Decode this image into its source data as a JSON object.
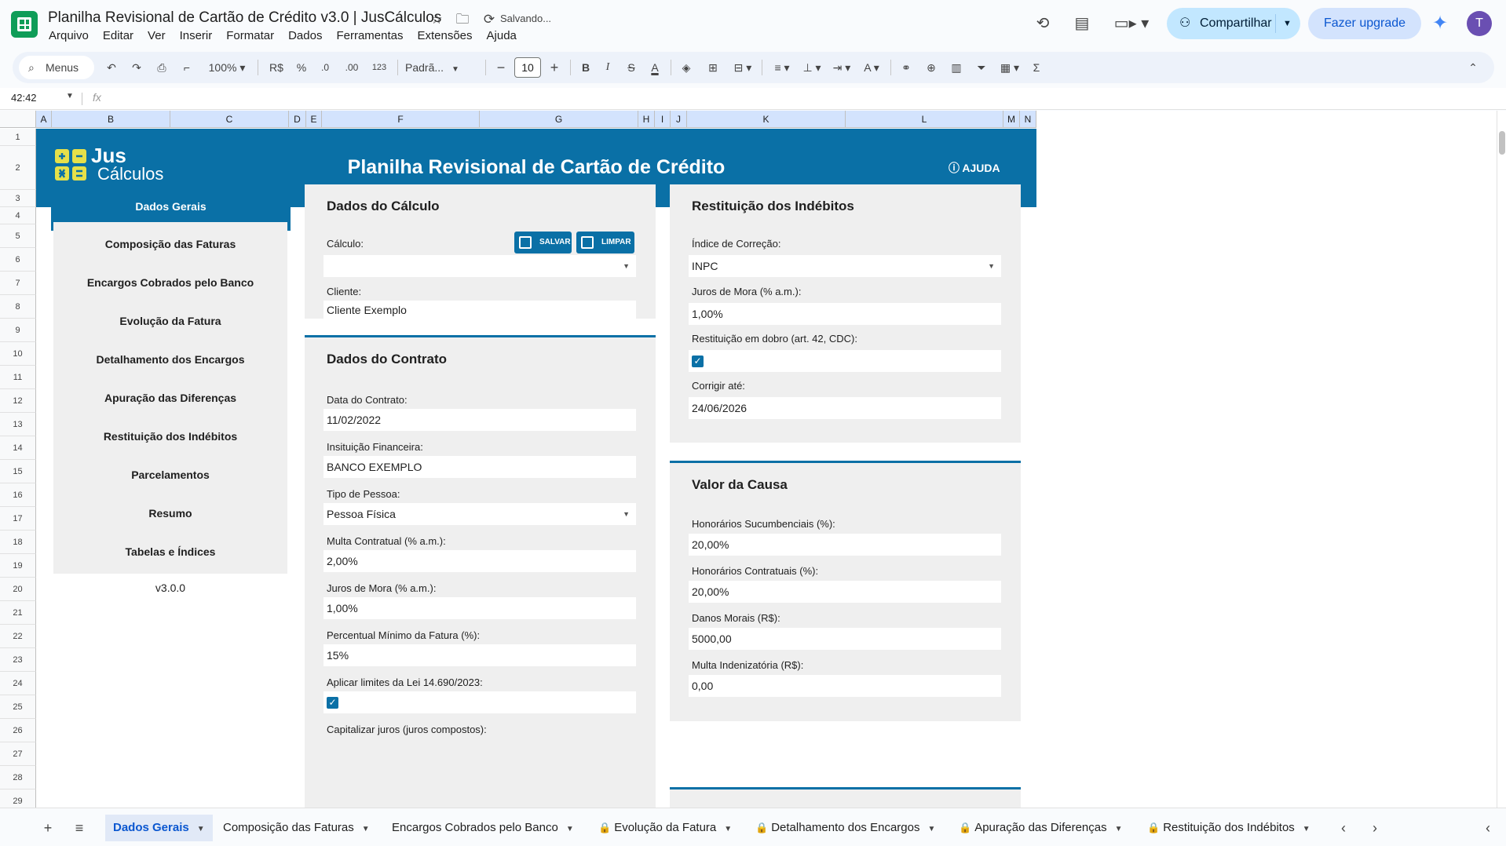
{
  "window": {
    "doc_title": "Planilha Revisional de Cartão de Crédito v3.0 | JusCálculos",
    "saving_status": "Salvando..."
  },
  "menu": [
    "Arquivo",
    "Editar",
    "Ver",
    "Inserir",
    "Formatar",
    "Dados",
    "Ferramentas",
    "Extensões",
    "Ajuda"
  ],
  "header_actions": {
    "share_label": "Compartilhar",
    "upgrade_label": "Fazer upgrade",
    "avatar_initial": "T"
  },
  "toolbar": {
    "menus_label": "Menus",
    "zoom": "100%",
    "currency": "R$",
    "percent": "%",
    "dec_decrease": ".0",
    "dec_increase": ".00",
    "num_format": "123",
    "font": "Padrã...",
    "font_size": "10"
  },
  "formula_bar": {
    "name_box": "42:42",
    "fx": "fx"
  },
  "columns": [
    "A",
    "B",
    "C",
    "D",
    "E",
    "F",
    "G",
    "H",
    "I",
    "J",
    "K",
    "L",
    "M",
    "N"
  ],
  "rows": [
    "1",
    "2",
    "3",
    "4",
    "5",
    "6",
    "7",
    "8",
    "9",
    "10",
    "11",
    "12",
    "13",
    "14",
    "15",
    "16",
    "17",
    "18",
    "19",
    "20",
    "21",
    "22",
    "23",
    "24",
    "25",
    "26",
    "27",
    "28",
    "29"
  ],
  "sheet": {
    "brand_top": "Jus",
    "brand_bottom": "Cálculos",
    "title": "Planilha Revisional de Cartão de Crédito",
    "help": "AJUDA",
    "version": "v3.0.0"
  },
  "nav": [
    {
      "label": "Dados Gerais",
      "active": true
    },
    {
      "label": "Composição das Faturas"
    },
    {
      "label": "Encargos Cobrados pelo Banco"
    },
    {
      "label": "Evolução da Fatura"
    },
    {
      "label": "Detalhamento dos Encargos"
    },
    {
      "label": "Apuração das Diferenças"
    },
    {
      "label": "Restituição dos Indébitos"
    },
    {
      "label": "Parcelamentos"
    },
    {
      "label": "Resumo"
    },
    {
      "label": "Tabelas e Índices"
    }
  ],
  "calc_panel": {
    "title": "Dados do Cálculo",
    "calc_label": "Cálculo:",
    "calc_value": "",
    "save_btn": "SALVAR",
    "clear_btn": "LIMPAR",
    "client_label": "Cliente:",
    "client_value": "Cliente Exemplo"
  },
  "contract_panel": {
    "title": "Dados do Contrato",
    "date_label": "Data do Contrato:",
    "date_value": "11/02/2022",
    "institution_label": "Insituição Financeira:",
    "institution_value": "BANCO EXEMPLO",
    "person_label": "Tipo de Pessoa:",
    "person_value": "Pessoa Física",
    "fine_label": "Multa Contratual (% a.m.):",
    "fine_value": "2,00%",
    "interest_label": "Juros de Mora (% a.m.):",
    "interest_value": "1,00%",
    "min_label": "Percentual Mínimo da Fatura (%):",
    "min_value": "15%",
    "law_label": "Aplicar limites da Lei 14.690/2023:",
    "law_checked": true,
    "cap_label": "Capitalizar juros (juros compostos):"
  },
  "refund_panel": {
    "title": "Restituição dos Indébitos",
    "index_label": "Índice de Correção:",
    "index_value": "INPC",
    "interest_label": "Juros de Mora (% a.m.):",
    "interest_value": "1,00%",
    "double_label": "Restituição em dobro (art. 42, CDC):",
    "double_checked": true,
    "until_label": "Corrigir até:",
    "until_value": "24/06/2026"
  },
  "cause_panel": {
    "title": "Valor da Causa",
    "succ_label": "Honorários Sucumbenciais (%):",
    "succ_value": "20,00%",
    "contr_label": "Honorários Contratuais (%):",
    "contr_value": "20,00%",
    "moral_label": "Danos Morais (R$):",
    "moral_value": "5000,00",
    "penalty_label": "Multa Indenizatória (R$):",
    "penalty_value": "0,00"
  },
  "tabs": [
    {
      "label": "Dados Gerais",
      "active": true,
      "locked": false
    },
    {
      "label": "Composição das Faturas",
      "locked": false
    },
    {
      "label": "Encargos Cobrados pelo Banco",
      "locked": false
    },
    {
      "label": "Evolução da Fatura",
      "locked": true
    },
    {
      "label": "Detalhamento dos Encargos",
      "locked": true
    },
    {
      "label": "Apuração das Diferenças",
      "locked": true
    },
    {
      "label": "Restituição dos Indébitos",
      "locked": true
    }
  ],
  "colors": {
    "accent": "#0a70a6",
    "header_band": "#0a70a6",
    "panel_bg": "#efefef",
    "logo_yellow": "#e5e04a"
  }
}
